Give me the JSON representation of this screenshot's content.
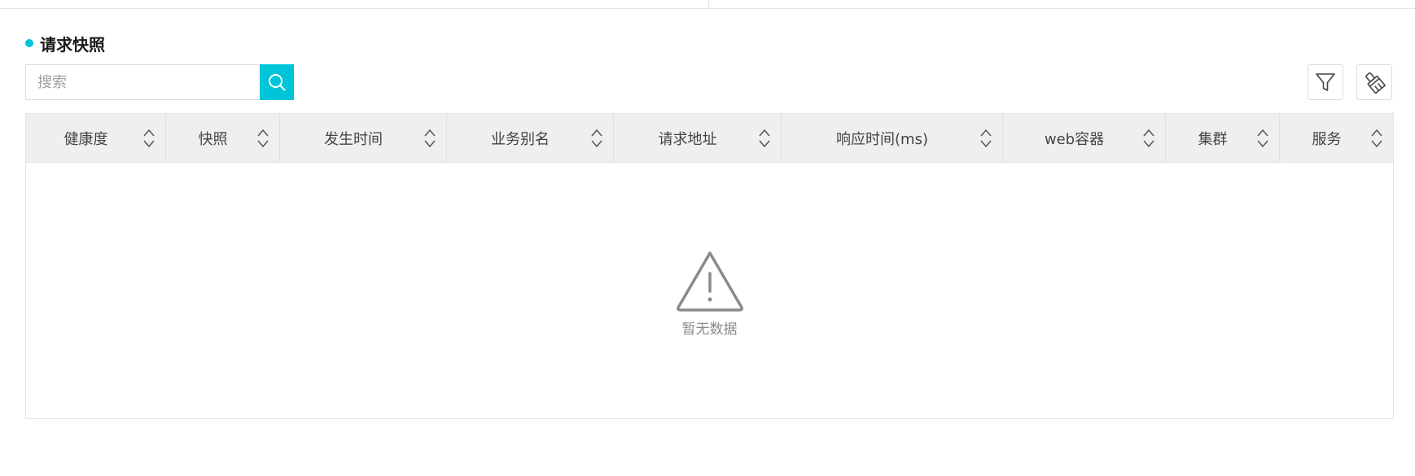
{
  "section": {
    "title": "请求快照",
    "accent_color": "#00c4d8"
  },
  "search": {
    "placeholder": "搜索",
    "value": "",
    "button_icon": "search-icon"
  },
  "toolbar": {
    "filter_icon": "filter-icon",
    "clear_icon": "broom-icon"
  },
  "table": {
    "columns": [
      {
        "label": "健康度"
      },
      {
        "label": "快照"
      },
      {
        "label": "发生时间"
      },
      {
        "label": "业务别名"
      },
      {
        "label": "请求地址"
      },
      {
        "label": "响应时间(ms)"
      },
      {
        "label": "web容器"
      },
      {
        "label": "集群"
      },
      {
        "label": "服务"
      }
    ],
    "rows": [],
    "empty_text": "暂无数据",
    "empty_icon": "warning-triangle-icon"
  }
}
